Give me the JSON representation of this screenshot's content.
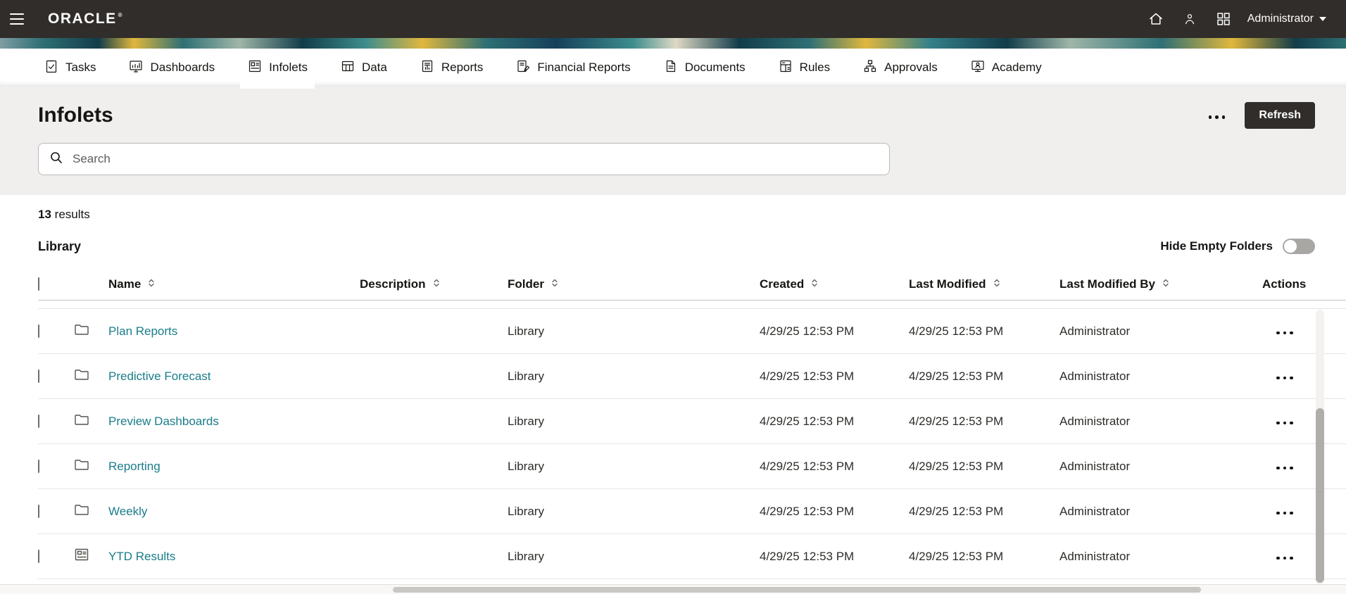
{
  "topbar": {
    "logo": "ORACLE",
    "logo_mark": "®",
    "user_label": "Administrator"
  },
  "nav": {
    "active_tab": "Infolets",
    "tabs": [
      {
        "label": "Tasks"
      },
      {
        "label": "Dashboards"
      },
      {
        "label": "Infolets"
      },
      {
        "label": "Data"
      },
      {
        "label": "Reports"
      },
      {
        "label": "Financial Reports"
      },
      {
        "label": "Documents"
      },
      {
        "label": "Rules"
      },
      {
        "label": "Approvals"
      },
      {
        "label": "Academy"
      }
    ]
  },
  "page": {
    "title": "Infolets",
    "refresh_label": "Refresh"
  },
  "search": {
    "placeholder": "Search"
  },
  "results": {
    "count": "13",
    "label": "results"
  },
  "library": {
    "label": "Library",
    "hide_empty_label": "Hide Empty Folders",
    "hide_empty_state": "off"
  },
  "table": {
    "headers": {
      "name": "Name",
      "description": "Description",
      "folder": "Folder",
      "created": "Created",
      "last_modified": "Last Modified",
      "last_modified_by": "Last Modified By",
      "actions": "Actions"
    },
    "rows": [
      {
        "icon": "folder",
        "name": "Plan Reports",
        "description": "",
        "folder": "Library",
        "created": "4/29/25 12:53 PM",
        "last_modified": "4/29/25 12:53 PM",
        "last_modified_by": "Administrator"
      },
      {
        "icon": "folder",
        "name": "Predictive Forecast",
        "description": "",
        "folder": "Library",
        "created": "4/29/25 12:53 PM",
        "last_modified": "4/29/25 12:53 PM",
        "last_modified_by": "Administrator"
      },
      {
        "icon": "folder",
        "name": "Preview Dashboards",
        "description": "",
        "folder": "Library",
        "created": "4/29/25 12:53 PM",
        "last_modified": "4/29/25 12:53 PM",
        "last_modified_by": "Administrator"
      },
      {
        "icon": "folder",
        "name": "Reporting",
        "description": "",
        "folder": "Library",
        "created": "4/29/25 12:53 PM",
        "last_modified": "4/29/25 12:53 PM",
        "last_modified_by": "Administrator"
      },
      {
        "icon": "folder",
        "name": "Weekly",
        "description": "",
        "folder": "Library",
        "created": "4/29/25 12:53 PM",
        "last_modified": "4/29/25 12:53 PM",
        "last_modified_by": "Administrator"
      },
      {
        "icon": "infolet",
        "name": "YTD Results",
        "description": "",
        "folder": "Library",
        "created": "4/29/25 12:53 PM",
        "last_modified": "4/29/25 12:53 PM",
        "last_modified_by": "Administrator"
      }
    ]
  },
  "colors": {
    "topbar_bg": "#312d2a",
    "page_header_bg": "#f1efed",
    "link": "#1a7d8a",
    "button_bg": "#312d2a",
    "text": "#161513"
  }
}
